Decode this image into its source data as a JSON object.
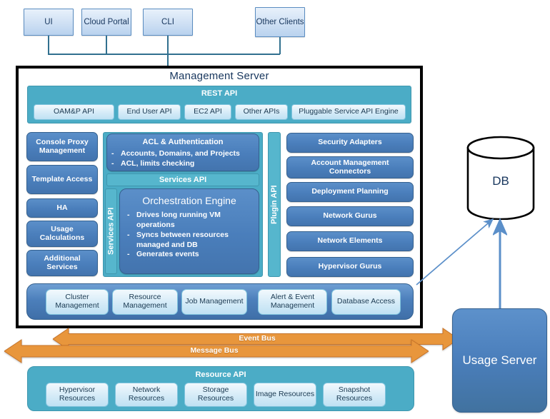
{
  "clients": [
    {
      "label": "UI"
    },
    {
      "label": "Cloud Portal"
    },
    {
      "label": "CLI"
    },
    {
      "label": "Other Clients"
    }
  ],
  "management_server": {
    "title": "Management Server",
    "rest_api": {
      "label": "REST API",
      "apis": [
        {
          "label": "OAM&P API"
        },
        {
          "label": "End User API"
        },
        {
          "label": "EC2 API"
        },
        {
          "label": "Other APIs"
        },
        {
          "label": "Pluggable Service API Engine"
        }
      ]
    },
    "left_column": [
      {
        "label": "Console Proxy Management"
      },
      {
        "label": "Template Access"
      },
      {
        "label": "HA"
      },
      {
        "label": "Usage Calculations"
      },
      {
        "label": "Additional Services"
      }
    ],
    "acl": {
      "title": "ACL & Authentication",
      "bullets": [
        "Accounts, Domains, and Projects",
        "ACL, limits checking"
      ]
    },
    "services_api_bar": "Services API",
    "services_api_vertical": "Services API",
    "plugin_api_vertical": "Plugin API",
    "orchestration": {
      "title": "Orchestration Engine",
      "bullets": [
        "Drives long running VM operations",
        "Syncs between resources managed and DB",
        "Generates events"
      ]
    },
    "right_column": [
      {
        "label": "Security Adapters"
      },
      {
        "label": "Account Management Connectors"
      },
      {
        "label": "Deployment Planning"
      },
      {
        "label": "Network Gurus"
      },
      {
        "label": "Network Elements"
      },
      {
        "label": "Hypervisor Gurus"
      }
    ],
    "bottom_row": [
      {
        "label": "Cluster Management"
      },
      {
        "label": "Resource Management"
      },
      {
        "label": "Job Management"
      },
      {
        "label": "Alert & Event Management"
      },
      {
        "label": "Database Access"
      }
    ]
  },
  "buses": [
    {
      "label": "Event Bus"
    },
    {
      "label": "Message Bus"
    }
  ],
  "resource_api": {
    "label": "Resource API",
    "resources": [
      {
        "label": "Hypervisor Resources"
      },
      {
        "label": "Network Resources"
      },
      {
        "label": "Storage Resources"
      },
      {
        "label": "Image Resources"
      },
      {
        "label": "Snapshot Resources"
      }
    ]
  },
  "database": {
    "label": "DB"
  },
  "usage_server": {
    "label": "Usage Server"
  },
  "colors": {
    "teal": "#4BACC6",
    "blue": "#4A7EBB",
    "orange": "#E8963C",
    "light_blue_pill": "#CDE7F5",
    "border_black": "#000000",
    "connector": "#31708F"
  }
}
